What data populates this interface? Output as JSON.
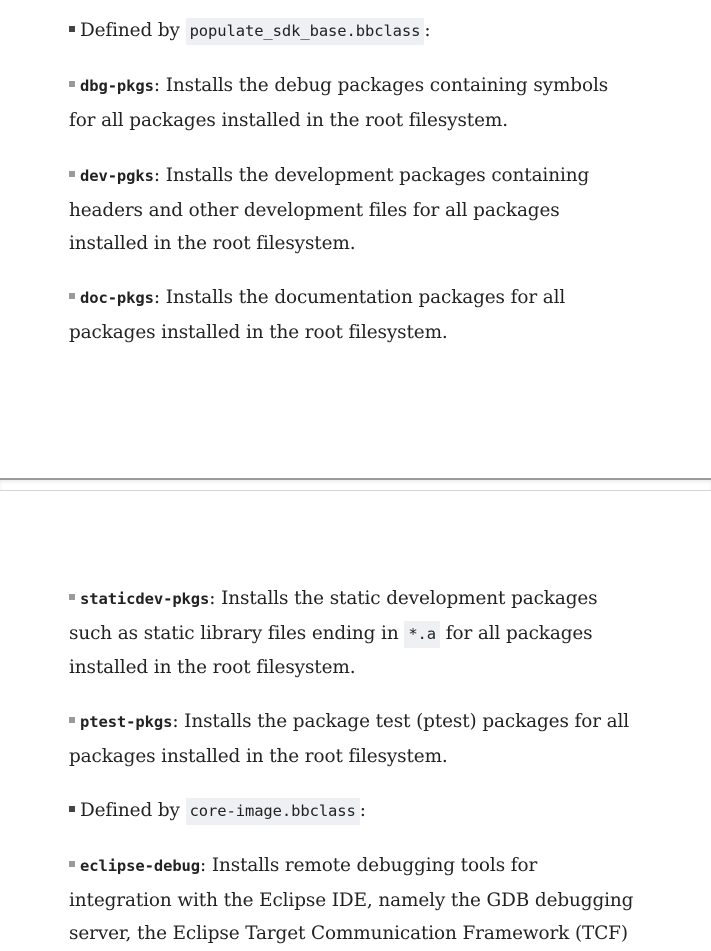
{
  "page_top": {
    "items": [
      {
        "kind": "defined",
        "prefix": "Defined by",
        "code": "populate_sdk_base.bbclass",
        "suffix": ":"
      },
      {
        "kind": "pkg",
        "keyword": "dbg-pkgs",
        "text": ": Installs the debug packages containing symbols for all packages installed in the root filesystem."
      },
      {
        "kind": "pkg",
        "keyword": "dev-pgks",
        "text": ": Installs the development packages containing headers and other development files for all packages installed in the root filesystem."
      },
      {
        "kind": "pkg",
        "keyword": "doc-pkgs",
        "text": ": Installs the documentation packages for all packages installed in the root filesystem."
      }
    ]
  },
  "page_bottom": {
    "staticdev": {
      "keyword": "staticdev-pkgs",
      "text_before": ": Installs the static development packages such as static library files ending in",
      "code": "*.a",
      "text_after": "for all packages installed in the root filesystem."
    },
    "ptest": {
      "keyword": "ptest-pkgs",
      "text": ": Installs the package test (ptest) packages for all packages installed in the root filesystem."
    },
    "defined": {
      "prefix": "Defined by",
      "code": "core-image.bbclass",
      "suffix": ":"
    },
    "eclipse": {
      "keyword": "eclipse-debug",
      "text": ": Installs remote debugging tools for integration with the Eclipse IDE, namely the GDB debugging server, the Eclipse Target Communication Framework (TCF)"
    }
  }
}
